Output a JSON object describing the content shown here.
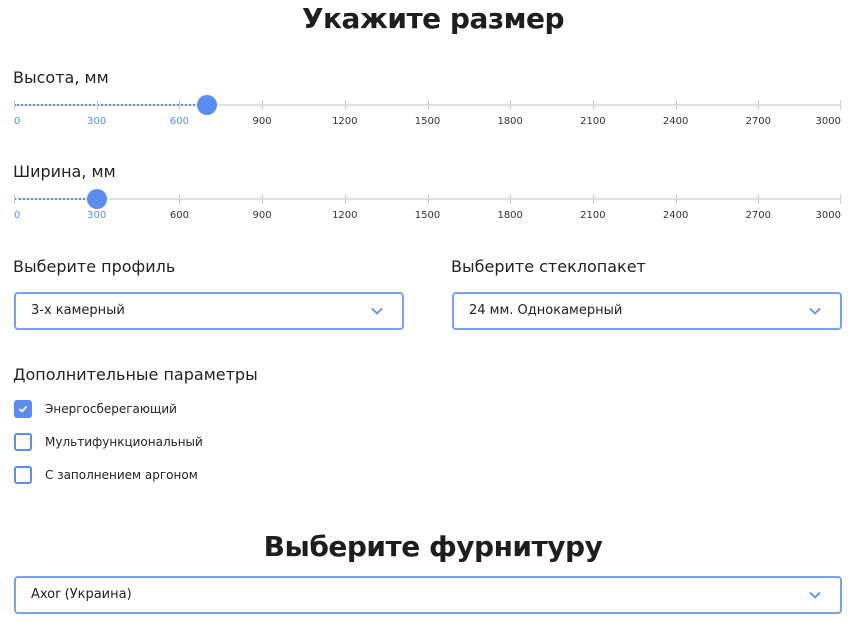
{
  "size_section": {
    "title": "Укажите размер"
  },
  "height_slider": {
    "label": "Высота, мм",
    "min": 0,
    "max": 3000,
    "value": 700,
    "ticks": [
      "0",
      "300",
      "600",
      "900",
      "1200",
      "1500",
      "1800",
      "2100",
      "2400",
      "2700",
      "3000"
    ]
  },
  "width_slider": {
    "label": "Ширина, мм",
    "min": 0,
    "max": 3000,
    "value": 300,
    "ticks": [
      "0",
      "300",
      "600",
      "900",
      "1200",
      "1500",
      "1800",
      "2100",
      "2400",
      "2700",
      "3000"
    ]
  },
  "profile": {
    "label": "Выберите профиль",
    "selected": "3-х камерный"
  },
  "glass": {
    "label": "Выберите стеклопакет",
    "selected": "24 мм. Однокамерный"
  },
  "extras": {
    "label": "Дополнительные параметры",
    "options": [
      {
        "label": "Энергосберегающий",
        "checked": true
      },
      {
        "label": "Мультифункциональный",
        "checked": false
      },
      {
        "label": "С заполнением аргоном",
        "checked": false
      }
    ]
  },
  "hardware_section": {
    "title": "Выберите фурнитуру",
    "selected": "Axor (Украина)"
  },
  "colors": {
    "accent": "#5b8def",
    "border": "#7aa0f0"
  },
  "icons": {
    "dropdown": "chevron-down-icon",
    "check": "check-icon"
  }
}
